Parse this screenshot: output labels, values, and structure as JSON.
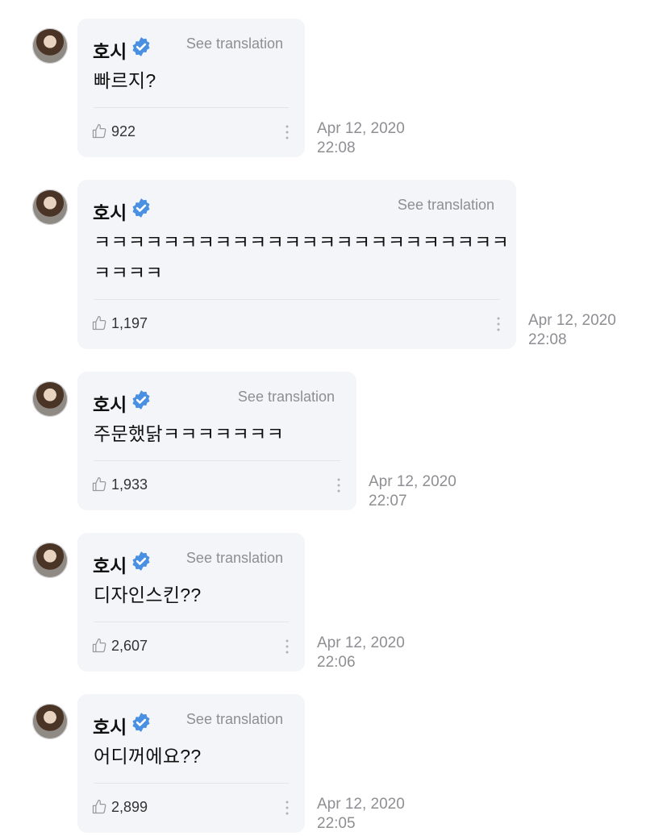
{
  "messages": [
    {
      "author": "호시",
      "see_translation": "See translation",
      "lines": [
        "빠르지?"
      ],
      "likes": "922",
      "date": "Apr 12, 2020",
      "time": "22:08"
    },
    {
      "author": "호시",
      "see_translation": "See translation",
      "lines": [
        "ㅋㅋㅋㅋㅋㅋㅋㅋㅋㅋㅋㅋㅋㅋㅋㅋㅋㅋㅋㅋㅋㅋㅋㅋ",
        "ㅋㅋㅋㅋ"
      ],
      "likes": "1,197",
      "date": "Apr 12, 2020",
      "time": "22:08"
    },
    {
      "author": "호시",
      "see_translation": "See translation",
      "lines": [
        "주문했닭ㅋㅋㅋㅋㅋㅋㅋ"
      ],
      "likes": "1,933",
      "date": "Apr 12, 2020",
      "time": "22:07"
    },
    {
      "author": "호시",
      "see_translation": "See translation",
      "lines": [
        "디자인스킨??"
      ],
      "likes": "2,607",
      "date": "Apr 12, 2020",
      "time": "22:06"
    },
    {
      "author": "호시",
      "see_translation": "See translation",
      "lines": [
        "어디꺼에요??"
      ],
      "likes": "2,899",
      "date": "Apr 12, 2020",
      "time": "22:05"
    }
  ],
  "icons": {
    "verified": "verified-badge-icon",
    "like": "thumbs-up-icon",
    "more": "vertical-ellipsis-icon",
    "avatar": "user-avatar"
  },
  "colors": {
    "bubble": "#f4f5f8",
    "verified": "#4a90e2",
    "muted": "#8e8e93"
  }
}
